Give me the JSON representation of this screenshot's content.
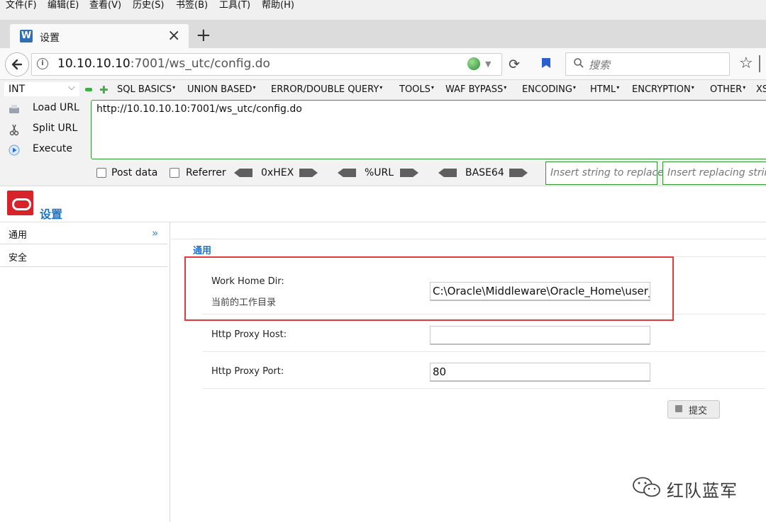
{
  "menubar": [
    "文件(F)",
    "编辑(E)",
    "查看(V)",
    "历史(S)",
    "书签(B)",
    "工具(T)",
    "帮助(H)"
  ],
  "tab": {
    "favicon": "W",
    "title": "设置"
  },
  "navbar": {
    "url_host": "10.10.10.10",
    "url_rest": ":7001/ws_utc/config.do",
    "search_placeholder": "搜索"
  },
  "hackbar": {
    "type_select": "INT",
    "menus": [
      "SQL BASICS",
      "UNION BASED",
      "ERROR/DOUBLE QUERY",
      "TOOLS",
      "WAF BYPASS",
      "ENCODING",
      "HTML",
      "ENCRYPTION",
      "OTHER",
      "XS"
    ],
    "load_url": "Load URL",
    "split_url": "Split URL",
    "execute": "Execute",
    "url_value": "http://10.10.10.10:7001/ws_utc/config.do",
    "post_data": "Post data",
    "referrer": "Referrer",
    "encoders": [
      "0xHEX",
      "%URL",
      "BASE64"
    ],
    "insert_string_placeholder": "Insert string to replace",
    "insert_replacing_placeholder": "Insert replacing string"
  },
  "page": {
    "title": "设置",
    "nav_items": [
      "通用",
      "安全"
    ],
    "section_title": "通用",
    "fields": [
      {
        "label": "Work Home Dir:",
        "desc": "当前的工作目录",
        "value": "C:\\Oracle\\Middleware\\Oracle_Home\\user_projects"
      },
      {
        "label": "Http Proxy Host:",
        "value": ""
      },
      {
        "label": "Http Proxy Port:",
        "value": "80"
      }
    ],
    "submit_label": "提交"
  },
  "watermark": "红队蓝军",
  "colors": {
    "brand_red": "#d6242a",
    "link_blue": "#1f73c9",
    "hackbar_green": "#2f9a2f",
    "highlight_red": "#e0393e"
  }
}
